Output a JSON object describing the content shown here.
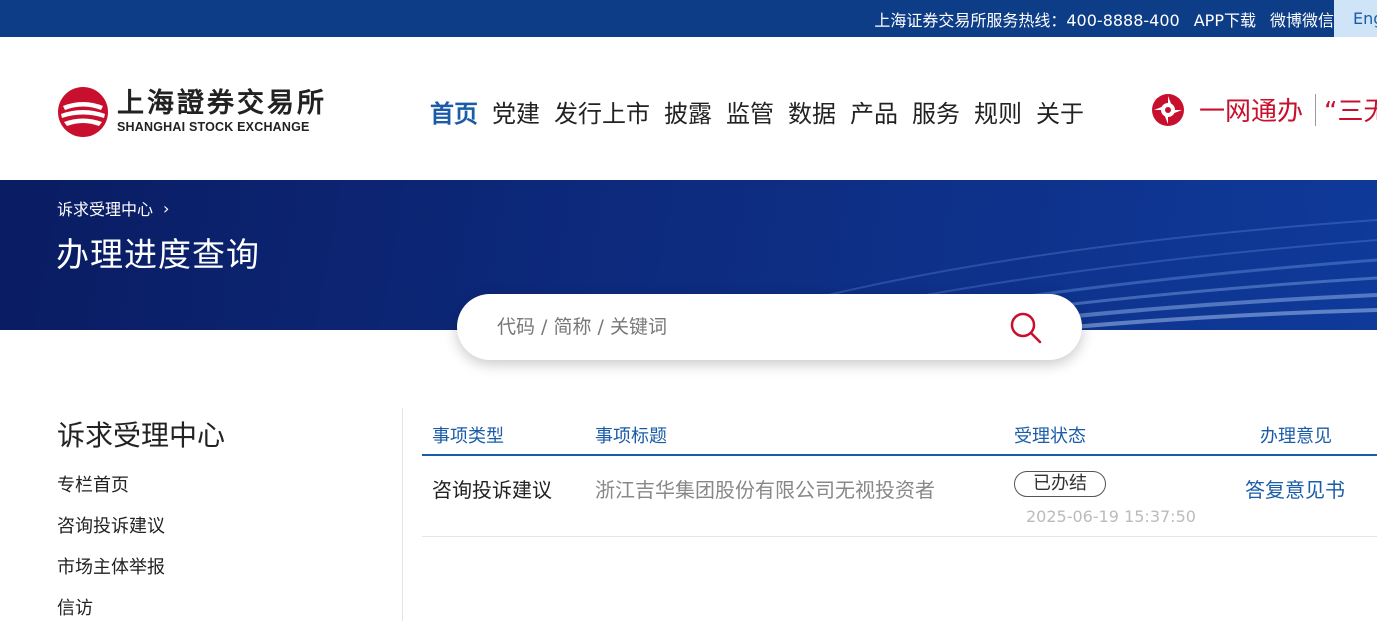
{
  "topbar": {
    "hotline": "上海证券交易所服务热线：400-8888-400",
    "app_download": "APP下载",
    "weibo_wechat": "微博微信",
    "language": "English"
  },
  "header": {
    "logo_cn": "上海證券交易所",
    "logo_en": "SHANGHAI STOCK EXCHANGE",
    "nav": [
      "首页",
      "党建",
      "发行上市",
      "披露",
      "监管",
      "数据",
      "产品",
      "服务",
      "规则",
      "关于"
    ],
    "active_nav": "首页",
    "gov_service": "一网通办",
    "gov_service_2": "“三无"
  },
  "banner": {
    "breadcrumb": "诉求受理中心",
    "title": "办理进度查询"
  },
  "search": {
    "placeholder": "代码 / 简称 / 关键词"
  },
  "sidebar": {
    "title": "诉求受理中心",
    "items": [
      "专栏首页",
      "咨询投诉建议",
      "市场主体举报",
      "信访"
    ]
  },
  "table": {
    "headers": [
      "事项类型",
      "事项标题",
      "受理状态",
      "办理意见"
    ],
    "rows": [
      {
        "type": "咨询投诉建议",
        "title": "浙江吉华集团股份有限公司无视投资者",
        "status": "已办结",
        "time": "2025-06-19 15:37:50",
        "opinion": "答复意见书"
      }
    ]
  },
  "colors": {
    "topbar_bg": "#0d3d87",
    "brand_blue": "#1b5ca8",
    "brand_red": "#c8102e",
    "banner_bg": "#0d2a7d"
  }
}
